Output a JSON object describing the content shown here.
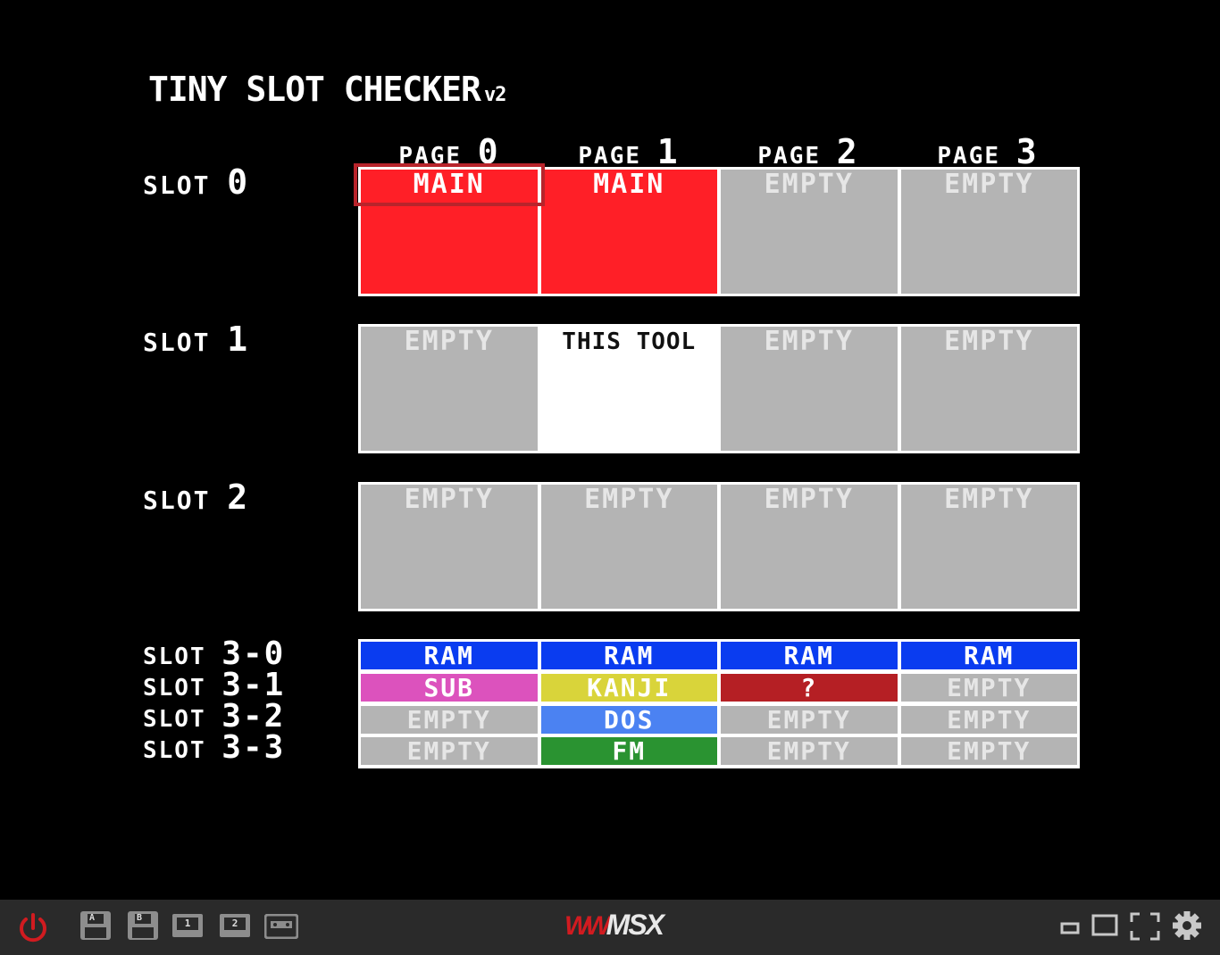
{
  "title": {
    "main": "TINY SLOT CHECKER",
    "version": "v2"
  },
  "pages": [
    {
      "prefix": "PAGE",
      "num": "0"
    },
    {
      "prefix": "PAGE",
      "num": "1"
    },
    {
      "prefix": "PAGE",
      "num": "2"
    },
    {
      "prefix": "PAGE",
      "num": "3"
    }
  ],
  "slots": [
    {
      "prefix": "SLOT",
      "num": "0",
      "cells": [
        {
          "label": "MAIN",
          "color": "#ff1f27"
        },
        {
          "label": "MAIN",
          "color": "#ff1f27"
        },
        {
          "label": "EMPTY",
          "color": "#b4b4b4"
        },
        {
          "label": "EMPTY",
          "color": "#b4b4b4"
        }
      ]
    },
    {
      "prefix": "SLOT",
      "num": "1",
      "cells": [
        {
          "label": "EMPTY",
          "color": "#b4b4b4"
        },
        {
          "label": "THIS TOOL",
          "color": "#ffffff"
        },
        {
          "label": "EMPTY",
          "color": "#b4b4b4"
        },
        {
          "label": "EMPTY",
          "color": "#b4b4b4"
        }
      ]
    },
    {
      "prefix": "SLOT",
      "num": "2",
      "cells": [
        {
          "label": "EMPTY",
          "color": "#b4b4b4"
        },
        {
          "label": "EMPTY",
          "color": "#b4b4b4"
        },
        {
          "label": "EMPTY",
          "color": "#b4b4b4"
        },
        {
          "label": "EMPTY",
          "color": "#b4b4b4"
        }
      ]
    }
  ],
  "subslots": [
    {
      "prefix": "SLOT",
      "num": "3-0",
      "cells": [
        {
          "label": "RAM",
          "color": "#0a3cf0"
        },
        {
          "label": "RAM",
          "color": "#0a3cf0"
        },
        {
          "label": "RAM",
          "color": "#0a3cf0"
        },
        {
          "label": "RAM",
          "color": "#0a3cf0"
        }
      ]
    },
    {
      "prefix": "SLOT",
      "num": "3-1",
      "cells": [
        {
          "label": "SUB",
          "color": "#dc52bd"
        },
        {
          "label": "KANJI",
          "color": "#d9d43a"
        },
        {
          "label": "?",
          "color": "#b51f24"
        },
        {
          "label": "EMPTY",
          "color": "#b4b4b4"
        }
      ]
    },
    {
      "prefix": "SLOT",
      "num": "3-2",
      "cells": [
        {
          "label": "EMPTY",
          "color": "#b4b4b4"
        },
        {
          "label": "DOS",
          "color": "#4b82f2"
        },
        {
          "label": "EMPTY",
          "color": "#b4b4b4"
        },
        {
          "label": "EMPTY",
          "color": "#b4b4b4"
        }
      ]
    },
    {
      "prefix": "SLOT",
      "num": "3-3",
      "cells": [
        {
          "label": "EMPTY",
          "color": "#b4b4b4"
        },
        {
          "label": "FM",
          "color": "#2a9331"
        },
        {
          "label": "EMPTY",
          "color": "#b4b4b4"
        },
        {
          "label": "EMPTY",
          "color": "#b4b4b4"
        }
      ]
    }
  ],
  "toolbar": {
    "power_icon": "power-icon",
    "drives": [
      {
        "icon": "floppy-disk-icon",
        "label": "A"
      },
      {
        "icon": "floppy-disk-icon",
        "label": "B"
      },
      {
        "icon": "cartridge-icon",
        "label": "1"
      },
      {
        "icon": "cartridge-icon",
        "label": "2"
      },
      {
        "icon": "cassette-tape-icon",
        "label": ""
      }
    ],
    "logo_mark": "W",
    "logo_text": "MSX",
    "right_icons": [
      "minimize-window-icon",
      "window-size-icon",
      "fullscreen-icon",
      "settings-gear-icon"
    ],
    "colors": {
      "accent": "#d11b20",
      "icon": "#8d8d8d",
      "bar": "#2a2a2a"
    }
  }
}
